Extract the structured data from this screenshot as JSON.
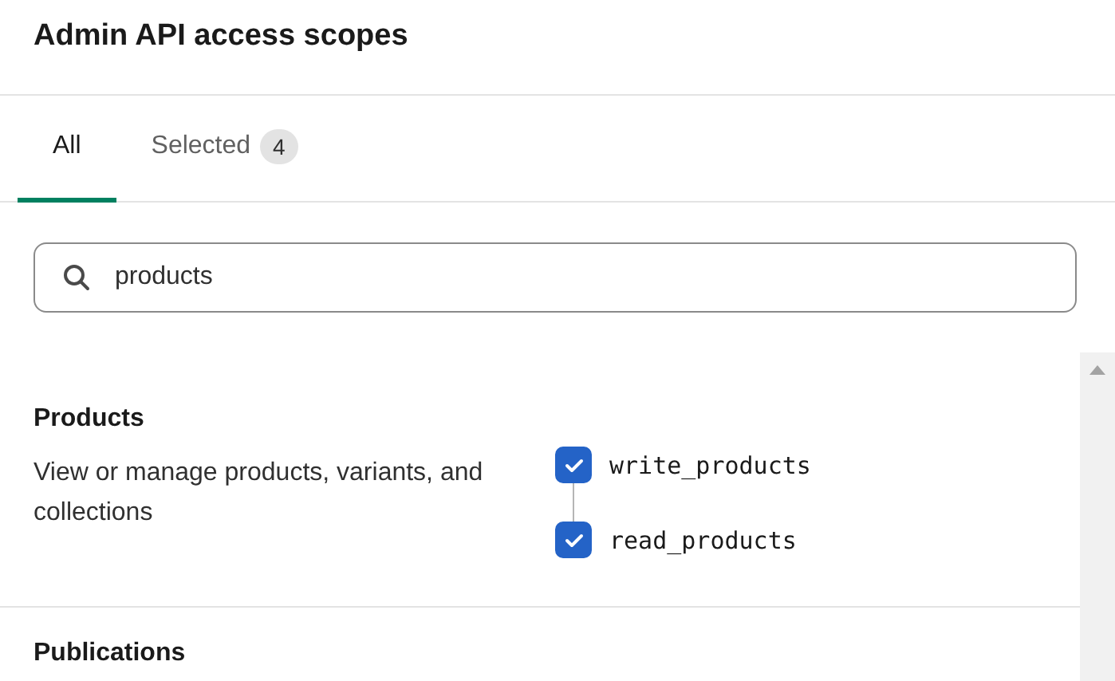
{
  "title": "Admin API access scopes",
  "tabs": [
    {
      "label": "All",
      "selected": true
    },
    {
      "label": "Selected",
      "badge": "4",
      "selected": false
    }
  ],
  "search": {
    "value": "products"
  },
  "sections": [
    {
      "heading": "Products",
      "description": "View or manage products, variants, and collections",
      "scopes": [
        {
          "label": "write_products",
          "checked": true
        },
        {
          "label": "read_products",
          "checked": true
        }
      ]
    },
    {
      "heading": "Publications"
    }
  ]
}
